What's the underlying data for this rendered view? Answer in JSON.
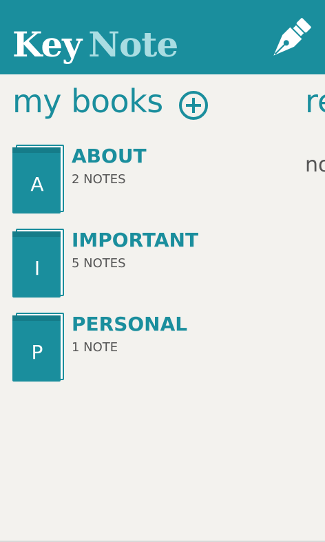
{
  "header": {
    "title_part1": "Key",
    "title_part2": "Note",
    "icon": "fountain-pen-icon"
  },
  "colors": {
    "accent": "#1a8e9d",
    "accent_light": "#a9dde2",
    "background": "#f3f2ee",
    "text_secondary": "#555555"
  },
  "section": {
    "title": "my books",
    "add_icon": "plus-circle-icon",
    "next_title": "re",
    "next_subtitle": "no"
  },
  "books": [
    {
      "letter": "A",
      "name": "ABOUT",
      "count": "2 NOTES"
    },
    {
      "letter": "I",
      "name": "IMPORTANT",
      "count": "5 NOTES"
    },
    {
      "letter": "P",
      "name": "PERSONAL",
      "count": "1 NOTE"
    }
  ]
}
